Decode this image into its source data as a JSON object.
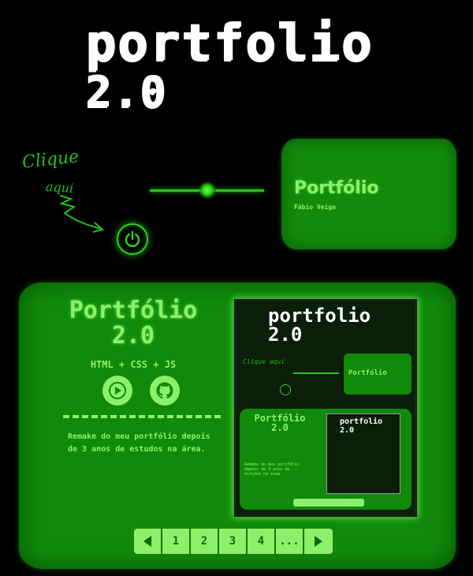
{
  "header": {
    "title_line1": "portfolio",
    "title_line2": "2.0"
  },
  "hint": {
    "line1": "Clique",
    "line2": "aqui"
  },
  "mini_screen": {
    "title": "Portfólio",
    "subtitle": "Fábio Veiga"
  },
  "main": {
    "title_line1": "Portfólio",
    "title_line2": "2.0",
    "tech": "HTML + CSS + JS",
    "description": "Remake do meu portfólio depois de 3 anos de estudos na área.",
    "preview": {
      "title": "portfolio",
      "title2": "2.0",
      "mini_label": "Portfólio",
      "big_title": "Portfólio 2.0",
      "shot_title": "portfolio 2.0",
      "hint": "Clique aqui",
      "desc": "Remake do meu portfólio depois de 3 anos de estudos na área."
    }
  },
  "pagination": {
    "pages": [
      "1",
      "2",
      "3",
      "4",
      "..."
    ]
  },
  "colors": {
    "screen": "#118a0b",
    "accent": "#8df06a",
    "glow": "#27c41a"
  },
  "icons": [
    "power-icon",
    "play-icon",
    "github-icon",
    "arrow-left-icon",
    "arrow-right-icon"
  ]
}
